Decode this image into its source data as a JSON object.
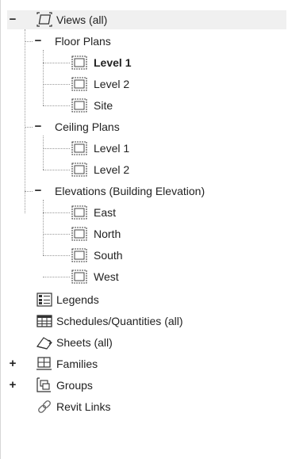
{
  "tree": {
    "root": {
      "label": "Views (all)",
      "toggle": "−",
      "icon": "views-icon"
    },
    "floor_plans": {
      "label": "Floor Plans",
      "toggle": "−",
      "items": [
        {
          "label": "Level 1",
          "bold": true,
          "icon": "view-icon"
        },
        {
          "label": "Level 2",
          "bold": false,
          "icon": "view-icon"
        },
        {
          "label": "Site",
          "bold": false,
          "icon": "view-icon"
        }
      ]
    },
    "ceiling_plans": {
      "label": "Ceiling Plans",
      "toggle": "−",
      "items": [
        {
          "label": "Level 1",
          "icon": "view-icon"
        },
        {
          "label": "Level 2",
          "icon": "view-icon"
        }
      ]
    },
    "elevations": {
      "label": "Elevations (Building Elevation)",
      "toggle": "−",
      "items": [
        {
          "label": "East",
          "icon": "view-icon"
        },
        {
          "label": "North",
          "icon": "view-icon"
        },
        {
          "label": "South",
          "icon": "view-icon"
        },
        {
          "label": "West",
          "icon": "view-icon"
        }
      ]
    },
    "legends": {
      "label": "Legends",
      "icon": "legend-icon"
    },
    "schedules": {
      "label": "Schedules/Quantities (all)",
      "icon": "schedule-icon"
    },
    "sheets": {
      "label": "Sheets (all)",
      "icon": "sheet-icon"
    },
    "families": {
      "label": "Families",
      "toggle": "+",
      "icon": "families-icon"
    },
    "groups": {
      "label": "Groups",
      "toggle": "+",
      "icon": "groups-icon"
    },
    "revit_links": {
      "label": "Revit Links",
      "icon": "link-icon"
    }
  },
  "colors": {
    "text": "#222222",
    "selection_bg": "#f0f0f0",
    "connector": "#999999"
  }
}
